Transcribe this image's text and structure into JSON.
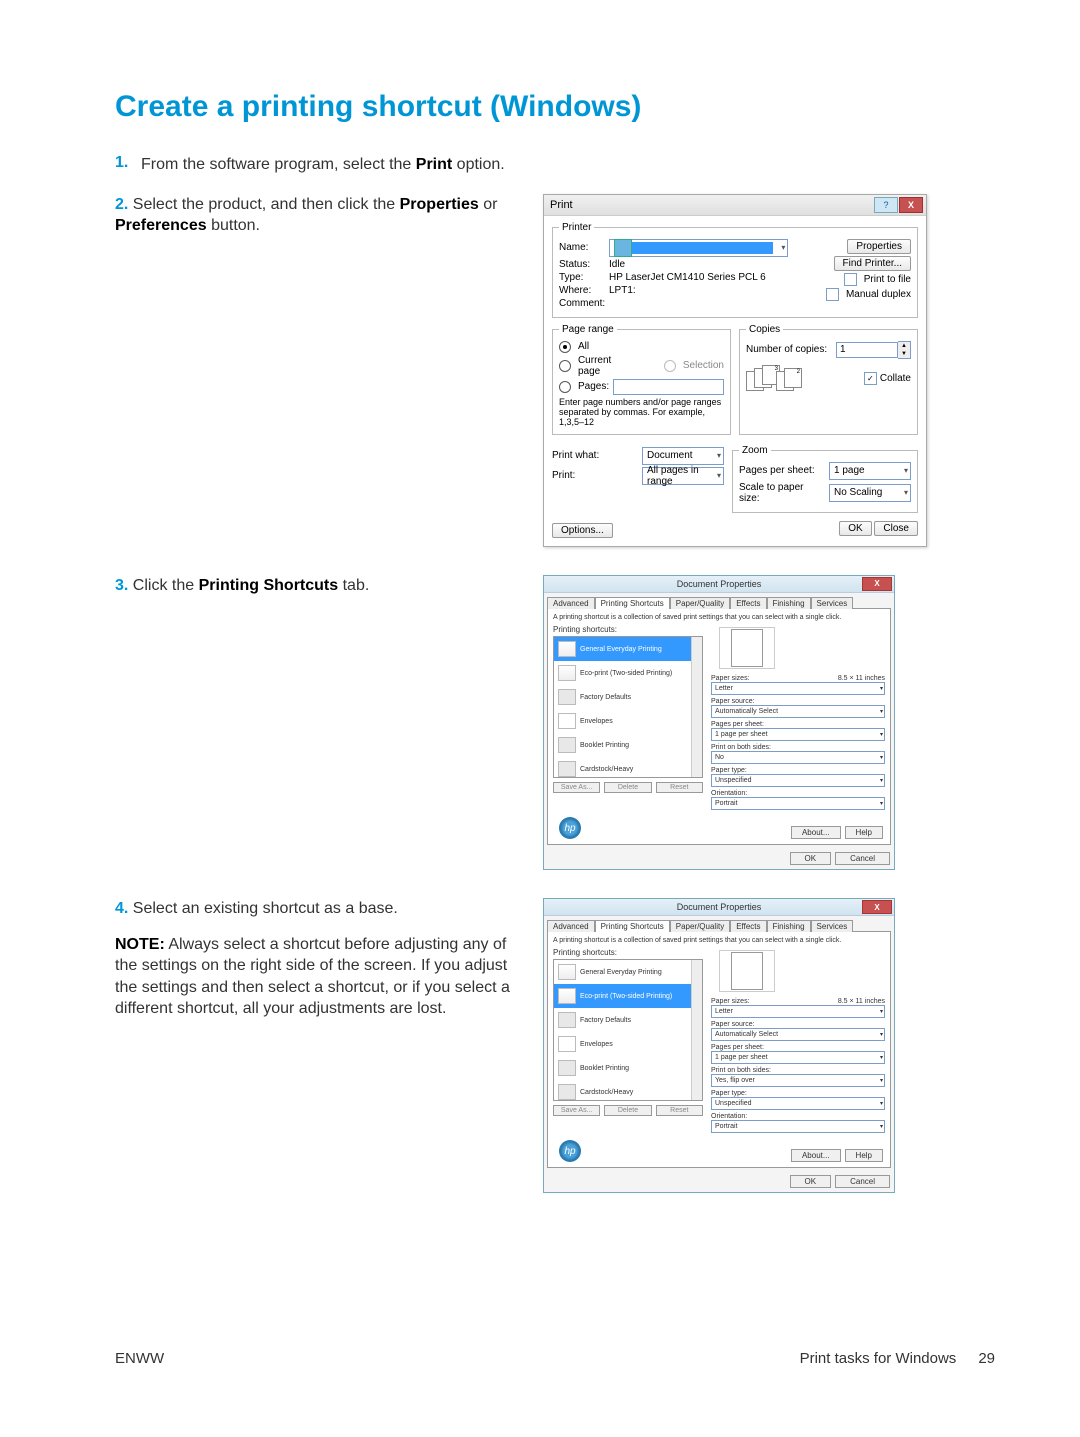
{
  "heading": "Create a printing shortcut (Windows)",
  "steps": {
    "s1": {
      "num": "1.",
      "text_a": "From the software program, select the ",
      "bold": "Print",
      "text_b": " option."
    },
    "s2": {
      "num": "2.",
      "text_a": "Select the product, and then click the ",
      "bold_a": "Properties",
      "mid": " or ",
      "bold_b": "Preferences",
      "text_b": " button."
    },
    "s3": {
      "num": "3.",
      "text_a": "Click the ",
      "bold": "Printing Shortcuts",
      "text_b": " tab."
    },
    "s4": {
      "num": "4.",
      "lead": "Select an existing shortcut as a base.",
      "note_label": "NOTE:",
      "note": " Always select a shortcut before adjusting any of the settings on the right side of the screen. If you adjust the settings and then select a shortcut, or if you select a different shortcut, all your adjustments are lost."
    }
  },
  "printDialog": {
    "title": "Print",
    "help_glyph": "?",
    "close_glyph": "X",
    "printer": {
      "legend": "Printer",
      "name_lbl": "Name:",
      "status_lbl": "Status:",
      "status": "Idle",
      "type_lbl": "Type:",
      "type": "HP LaserJet CM1410 Series PCL 6",
      "where_lbl": "Where:",
      "where": "LPT1:",
      "comment_lbl": "Comment:",
      "properties_btn": "Properties",
      "find_btn": "Find Printer...",
      "print_to_file": "Print to file",
      "manual_duplex": "Manual duplex"
    },
    "page_range": {
      "legend": "Page range",
      "all": "All",
      "current": "Current page",
      "selection": "Selection",
      "pages": "Pages:",
      "hint": "Enter page numbers and/or page ranges separated by commas. For example, 1,3,5–12"
    },
    "copies": {
      "legend": "Copies",
      "num_lbl": "Number of copies:",
      "num": "1",
      "collate": "Collate"
    },
    "print_what_lbl": "Print what:",
    "print_what": "Document",
    "print_lbl": "Print:",
    "print_range": "All pages in range",
    "zoom": {
      "legend": "Zoom",
      "pps_lbl": "Pages per sheet:",
      "pps": "1 page",
      "scale_lbl": "Scale to paper size:",
      "scale": "No Scaling"
    },
    "options_btn": "Options...",
    "ok_btn": "OK",
    "close_btn": "Close"
  },
  "propDialog": {
    "title": "Document Properties",
    "tabs": {
      "advanced": "Advanced",
      "shortcuts": "Printing Shortcuts",
      "paper": "Paper/Quality",
      "effects": "Effects",
      "finishing": "Finishing",
      "services": "Services"
    },
    "desc": "A printing shortcut is a collection of saved print settings that you can select with a single click.",
    "list_label": "Printing shortcuts:",
    "items": {
      "everyday": "General Everyday Printing",
      "eco": "Eco-print (Two-sided Printing)",
      "factory": "Factory Defaults",
      "env": "Envelopes",
      "booklet": "Booklet Printing",
      "card": "Cardstock/Heavy"
    },
    "btns": {
      "save": "Save As...",
      "delete": "Delete",
      "reset": "Reset"
    },
    "settings": {
      "papersize_lbl": "Paper sizes:",
      "papersize_dim": "8.5 × 11 inches",
      "papersize": "Letter",
      "source_lbl": "Paper source:",
      "source": "Automatically Select",
      "pps_lbl": "Pages per sheet:",
      "pps": "1 page per sheet",
      "both_lbl": "Print on both sides:",
      "both_no": "No",
      "both_yes": "Yes, flip over",
      "type_lbl": "Paper type:",
      "type": "Unspecified",
      "orient_lbl": "Orientation:",
      "orient": "Portrait"
    },
    "about": "About...",
    "help": "Help",
    "ok": "OK",
    "cancel": "Cancel",
    "hp": "hp"
  },
  "footer": {
    "left": "ENWW",
    "right": "Print tasks for Windows",
    "page": "29"
  }
}
